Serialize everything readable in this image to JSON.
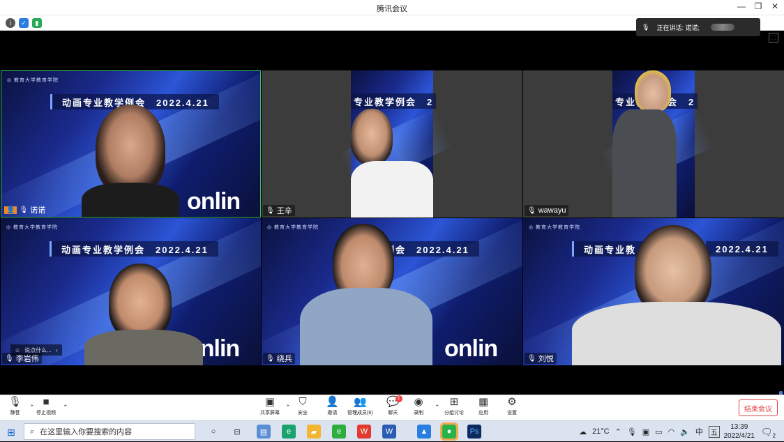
{
  "window": {
    "title": "腾讯会议",
    "controls": [
      "—",
      "❐",
      "✕"
    ]
  },
  "infobar": {
    "icons": [
      "info-icon",
      "shield-icon",
      "signal-icon"
    ]
  },
  "speaking": {
    "label": "正在讲话: 诺诺;"
  },
  "slide": {
    "banner": "动画专业教学例会　2022.4.21",
    "banner_partial_1": "专业教学例会　2",
    "banner_partial_2": "专业教学例会　2",
    "banner_partial_3": "例会　2022.4.21",
    "banner_partial_4": "动画专业教",
    "banner_partial_5": "2022.4.21",
    "online": "onlin",
    "logo": "◎ 教育大学教育学院"
  },
  "participants": [
    {
      "name": "诺诺",
      "host": true
    },
    {
      "name": "王辛"
    },
    {
      "name": "wawayu"
    },
    {
      "name": "李岩伟"
    },
    {
      "name": "绕兵"
    },
    {
      "name": "刘悦"
    }
  ],
  "chat_popup": {
    "text": "说点什么...",
    "icon": "smile-icon",
    "arrow": "‹"
  },
  "toolbar": {
    "mute": "静音",
    "stop_video": "停止视频",
    "share": "共享屏幕",
    "security": "安全",
    "invite": "邀请",
    "manage": "管理成员(6)",
    "chat": "聊天",
    "chat_badge": "1",
    "record": "录制",
    "breakout": "分组讨论",
    "apps": "应用",
    "settings": "设置",
    "end": "结束会议"
  },
  "taskbar": {
    "search_placeholder": "在这里输入你要搜索的内容",
    "weather": "21°C",
    "ime_lang": "中",
    "ime_mode": "五",
    "time": "13:39",
    "date": "2022/4/21",
    "notif_count": "2"
  },
  "colors": {
    "accent": "#0a63c9",
    "end_red": "#e24040",
    "speaker_border": "#37c36c"
  }
}
